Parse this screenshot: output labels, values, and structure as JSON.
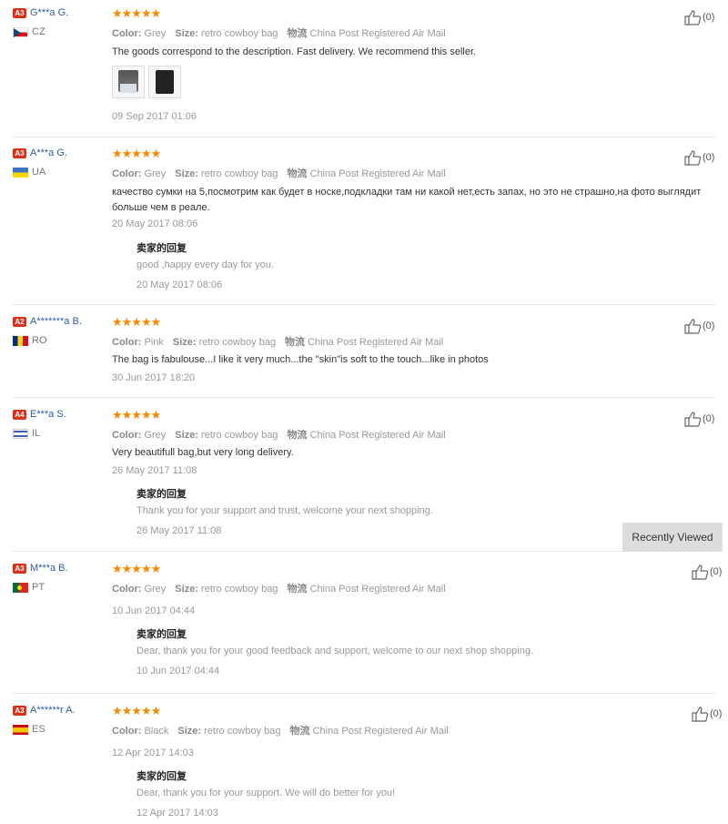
{
  "recently_viewed_label": "Recently Viewed",
  "reply_title": "卖家的回复",
  "labels": {
    "color": "Color:",
    "size": "Size:",
    "shipping": "物流"
  },
  "colors": {
    "username": "#2d5d9f",
    "level_badge": "#d9321c",
    "stars": "#f28b00",
    "muted": "#999999"
  },
  "reviews": [
    {
      "level": "A3",
      "user": "G***a G.",
      "country": "CZ",
      "stars": "★★★★★",
      "color": "Grey",
      "size": "retro cowboy bag",
      "shipping": "China Post Registered Air Mail",
      "text": "The goods correspond to the description. Fast delivery. We recommend this seller.",
      "date": "09 Sep 2017 01:06",
      "likes": "(0)"
    },
    {
      "level": "A3",
      "user": "A***a G.",
      "country": "UA",
      "stars": "★★★★★",
      "color": "Grey",
      "size": "retro cowboy bag",
      "shipping": "China Post Registered Air Mail",
      "text": "качество сумки на 5,посмотрим как будет в носке,подкладки там ни какой нет,есть запах, но это не страшно,на фото выглядит больше чем в реале.",
      "date": "20 May 2017 08:06",
      "likes": "(0)",
      "reply": {
        "text": "good ,happy every day for you.",
        "date": "20 May 2017 08:06"
      }
    },
    {
      "level": "A2",
      "user": "A*******a B.",
      "country": "RO",
      "stars": "★★★★★",
      "color": "Pink",
      "size": "retro cowboy bag",
      "shipping": "China Post Registered Air Mail",
      "text": "The bag is fabulouse...I like it very much...the \"skin\"is soft to the touch...like in photos",
      "date": "30 Jun 2017 18:20",
      "likes": "(0)"
    },
    {
      "level": "A4",
      "user": "E***a S.",
      "country": "IL",
      "stars": "★★★★★",
      "color": "Grey",
      "size": "retro cowboy bag",
      "shipping": "China Post Registered Air Mail",
      "text": "Very beautifull bag,but very long delivery.",
      "date": "26 May 2017 11:08",
      "likes": "(0)",
      "reply": {
        "text": "Thank you for your support and trust, welcome your next shopping.",
        "date": "26 May 2017 11:08"
      }
    },
    {
      "level": "A3",
      "user": "M***a B.",
      "country": "PT",
      "stars": "★★★★★",
      "color": "Grey",
      "size": "retro cowboy bag",
      "shipping": "China Post Registered Air Mail",
      "date": "10 Jun 2017 04:44",
      "likes": "(0)",
      "reply": {
        "text": "Dear, thank you for your good feedback and support, welcome to our next shop shopping.",
        "date": "10 Jun 2017 04:44"
      }
    },
    {
      "level": "A3",
      "user": "A******r A.",
      "country": "ES",
      "stars": "★★★★★",
      "color": "Black",
      "size": "retro cowboy bag",
      "shipping": "China Post Registered Air Mail",
      "date": "12 Apr 2017 14:03",
      "likes": "(0)",
      "reply": {
        "text": "Dear, thank you for your support. We will do better for you!",
        "date": "12 Apr 2017 14:03"
      }
    }
  ]
}
